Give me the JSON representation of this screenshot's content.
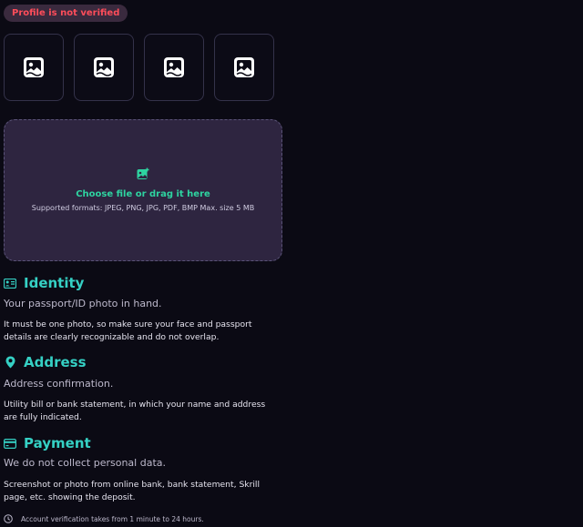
{
  "status_badge": "Profile is not verified",
  "thumbnails": [
    {
      "icon": "image-placeholder-icon"
    },
    {
      "icon": "image-placeholder-icon"
    },
    {
      "icon": "image-placeholder-icon"
    },
    {
      "icon": "image-placeholder-icon"
    }
  ],
  "dropzone": {
    "icon": "image-plus-icon",
    "title": "Choose file or drag it here",
    "formats": "Supported formats: JPEG, PNG, JPG, PDF, BMP Max. size 5 MB"
  },
  "sections": {
    "identity": {
      "icon": "id-card-icon",
      "title": "Identity",
      "subtitle": "Your passport/ID photo in hand.",
      "description": "It must be one photo, so make sure your face and passport details are clearly recognizable and do not overlap."
    },
    "address": {
      "icon": "location-pin-icon",
      "title": "Address",
      "subtitle": "Address confirmation.",
      "description": "Utility bill or bank statement, in which your name and address are fully indicated."
    },
    "payment": {
      "icon": "credit-card-icon",
      "title": "Payment",
      "subtitle": "We do not collect personal data.",
      "description": "Screenshot or photo from online bank, bank statement, Skrill page, etc. showing the deposit."
    }
  },
  "footer": {
    "icon": "clock-icon",
    "note": "Account verification takes from 1 minute to 24 hours."
  },
  "colors": {
    "background": "#0b0a14",
    "accent_teal": "#35d0c4",
    "accent_green": "#2ed3a0",
    "badge_text": "#ff4d5a",
    "dropzone_bg": "#2e2540"
  }
}
